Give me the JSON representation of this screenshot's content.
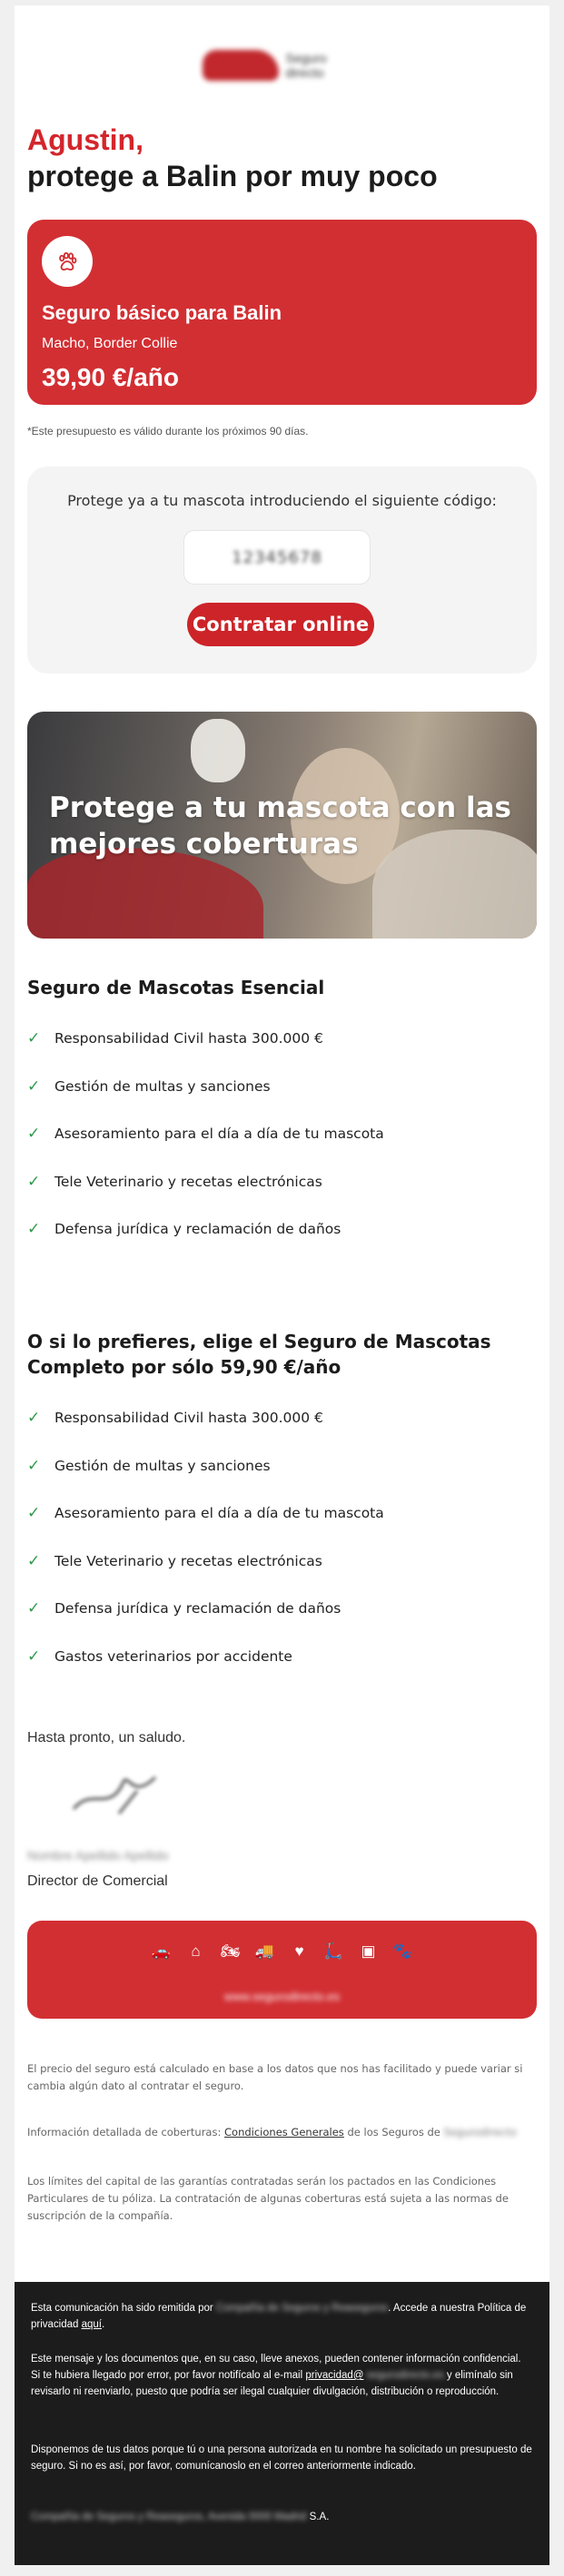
{
  "header": {
    "logo_text": "Seguro directo"
  },
  "greeting": {
    "name": "Agustin,",
    "subtitle": "protege a Balin por muy poco"
  },
  "quote_card": {
    "title": "Seguro básico para Balin",
    "detail": "Macho, Border Collie",
    "price": "39,90 €/año"
  },
  "validity_note": "*Este presupuesto es válido durante los próximos 90 días.",
  "code_box": {
    "label": "Protege ya a tu mascota introduciendo el siguiente código:",
    "code": "12345678",
    "button": "Contratar online"
  },
  "hero": {
    "headline": "Protege a tu mascota con las mejores coberturas"
  },
  "plan_essential": {
    "title": "Seguro de Mascotas Esencial",
    "benefits": [
      "Responsabilidad Civil hasta 300.000 €",
      "Gestión de multas y sanciones",
      "Asesoramiento para el día a día de tu mascota",
      "Tele Veterinario y recetas electrónicas",
      "Defensa jurídica y reclamación de daños"
    ]
  },
  "plan_complete": {
    "title": "O si lo prefieres, elige el Seguro de Mascotas Completo por sólo 59,90 €/año",
    "benefits": [
      "Responsabilidad Civil hasta 300.000 €",
      "Gestión de multas y sanciones",
      "Asesoramiento para el día a día de tu mascota",
      "Tele Veterinario y recetas electrónicas",
      "Defensa jurídica y reclamación de daños",
      "Gastos veterinarios por accidente"
    ]
  },
  "signoff": {
    "farewell": "Hasta pronto, un saludo.",
    "signer_name": "Nombre Apellido Apellido",
    "role": "Director de Comercial"
  },
  "red_bar": {
    "icons": [
      "car-icon",
      "home-icon",
      "motorbike-icon",
      "van-icon",
      "heart-icon",
      "scooter-icon",
      "shop-icon",
      "paw-icon"
    ],
    "link_text": "www.segurodirecto.es"
  },
  "fine_print": {
    "pricing": "El precio del seguro está calculado en base a los datos que nos has facilitado y puede variar si cambia algún dato al contratar el seguro.",
    "coverage_prefix": "Información detallada de coberturas:",
    "coverage_link": "Condiciones Generales",
    "coverage_suffix": "de los Seguros de",
    "coverage_brand": "Segurodirecto",
    "limits": "Los límites del capital de las garantías contratadas serán los pactados en las Condiciones Particulares de tu póliza. La contratación de algunas coberturas está sujeta a las normas de suscripción de la compañía."
  },
  "footer": {
    "p1_prefix": "Esta comunicación ha sido remitida por",
    "p1_sender": "Compañía de Seguros y Reaseguros",
    "p1_middle": ". Accede a nuestra Política de privacidad",
    "p1_link": "aquí",
    "p2_text": "Este mensaje y los documentos que, en su caso, lleve anexos, pueden contener información confidencial. Si te hubiera llegado por error, por favor notifícalo al e-mail",
    "p2_email_a": "privacidad@",
    "p2_email_b": "segurodirecto.es",
    "p2_text2": "y elimínalo sin revisarlo ni reenviarlo, puesto que podría ser ilegal cualquier divulgación, distribución o reproducción.",
    "p3_text": "Disponemos de tus datos porque tú o una persona autorizada en tu nombre ha solicitado un presupuesto de seguro. Si no es así, por favor, comunícanoslo en el correo anteriormente indicado.",
    "p4_blur": "Compañía de Seguros y Reaseguros, Avenida 0000 Madrid",
    "p4_suffix": "S.A."
  }
}
